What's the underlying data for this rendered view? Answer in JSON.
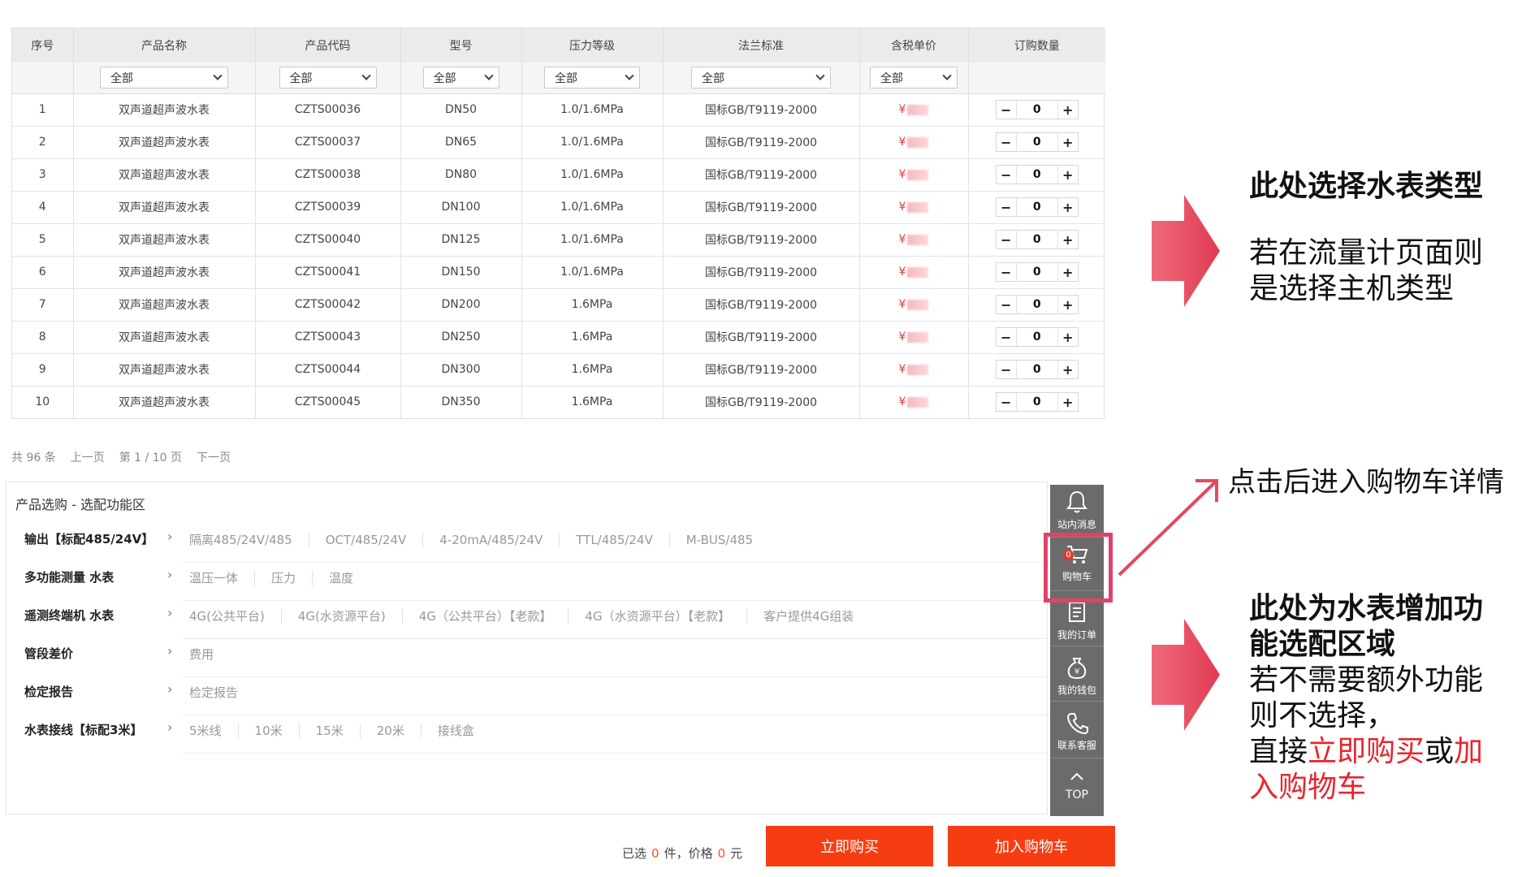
{
  "table": {
    "headers": [
      "序号",
      "产品名称",
      "产品代码",
      "型号",
      "压力等级",
      "法兰标准",
      "含税单价",
      "订购数量"
    ],
    "filter_value": "全部",
    "price_symbol": "¥",
    "rows": [
      {
        "no": "1",
        "name": "双声道超声波水表",
        "code": "CZTS00036",
        "model": "DN50",
        "pressure": "1.0/1.6MPa",
        "standard": "国标GB/T9119-2000",
        "qty": "0"
      },
      {
        "no": "2",
        "name": "双声道超声波水表",
        "code": "CZTS00037",
        "model": "DN65",
        "pressure": "1.0/1.6MPa",
        "standard": "国标GB/T9119-2000",
        "qty": "0"
      },
      {
        "no": "3",
        "name": "双声道超声波水表",
        "code": "CZTS00038",
        "model": "DN80",
        "pressure": "1.0/1.6MPa",
        "standard": "国标GB/T9119-2000",
        "qty": "0"
      },
      {
        "no": "4",
        "name": "双声道超声波水表",
        "code": "CZTS00039",
        "model": "DN100",
        "pressure": "1.0/1.6MPa",
        "standard": "国标GB/T9119-2000",
        "qty": "0"
      },
      {
        "no": "5",
        "name": "双声道超声波水表",
        "code": "CZTS00040",
        "model": "DN125",
        "pressure": "1.0/1.6MPa",
        "standard": "国标GB/T9119-2000",
        "qty": "0"
      },
      {
        "no": "6",
        "name": "双声道超声波水表",
        "code": "CZTS00041",
        "model": "DN150",
        "pressure": "1.0/1.6MPa",
        "standard": "国标GB/T9119-2000",
        "qty": "0"
      },
      {
        "no": "7",
        "name": "双声道超声波水表",
        "code": "CZTS00042",
        "model": "DN200",
        "pressure": "1.6MPa",
        "standard": "国标GB/T9119-2000",
        "qty": "0"
      },
      {
        "no": "8",
        "name": "双声道超声波水表",
        "code": "CZTS00043",
        "model": "DN250",
        "pressure": "1.6MPa",
        "standard": "国标GB/T9119-2000",
        "qty": "0"
      },
      {
        "no": "9",
        "name": "双声道超声波水表",
        "code": "CZTS00044",
        "model": "DN300",
        "pressure": "1.6MPa",
        "standard": "国标GB/T9119-2000",
        "qty": "0"
      },
      {
        "no": "10",
        "name": "双声道超声波水表",
        "code": "CZTS00045",
        "model": "DN350",
        "pressure": "1.6MPa",
        "standard": "国标GB/T9119-2000",
        "qty": "0"
      }
    ]
  },
  "pager": {
    "total": "共 96 条",
    "prev": "上一页",
    "current": "第 1 / 10 页",
    "next": "下一页"
  },
  "options": {
    "title": "产品选购 - 选配功能区",
    "caret": "›",
    "groups": [
      {
        "label": "输出【标配485/24V】",
        "items": [
          "隔离485/24V/485",
          "OCT/485/24V",
          "4-20mA/485/24V",
          "TTL/485/24V",
          "M-BUS/485"
        ]
      },
      {
        "label": "多功能测量 水表",
        "items": [
          "温压一体",
          "压力",
          "温度"
        ]
      },
      {
        "label": "遥测终端机 水表",
        "items": [
          "4G(公共平台)",
          "4G(水资源平台)",
          "4G（公共平台）【老款】",
          "4G（水资源平台）【老款】",
          "客户提供4G组装"
        ]
      },
      {
        "label": "管段差价",
        "items": [
          "费用"
        ]
      },
      {
        "label": "检定报告",
        "items": [
          "检定报告"
        ]
      },
      {
        "label": "水表接线【标配3米】",
        "items": [
          "5米线",
          "10米",
          "15米",
          "20米",
          "接线盒"
        ]
      }
    ]
  },
  "toolbar": {
    "messages": "站内消息",
    "cart": "购物车",
    "cart_count": "0",
    "orders": "我的订单",
    "wallet": "我的钱包",
    "service": "联系客服",
    "top": "TOP"
  },
  "buy_bar": {
    "selected_prefix": "已选",
    "selected_count": "0",
    "selected_unit": "件，价格",
    "price": "0",
    "currency": "元",
    "buy_now": "立即购买",
    "add_to_cart": "加入购物车"
  },
  "annotations": {
    "meter_type_title": "此处选择水表类型",
    "meter_type_body_1": "若在流量计页面则",
    "meter_type_body_2": "是选择主机类型",
    "cart_hint": "点击后进入购物车详情",
    "options_title_1": "此处为水表增加功",
    "options_title_2": "能选配区域",
    "options_body_1": "若不需要额外功能",
    "options_body_2": "则不选择，",
    "options_body_3_prefix": "直接",
    "options_body_3_buy": "立即购买",
    "options_body_3_or": "或",
    "options_body_3_cart_a": "加",
    "options_body_4_cart_b": "入购物车"
  },
  "colors": {
    "accent_red": "#f63d12",
    "annotation_red": "#e8262f",
    "arrow_pink": "#e24a5e",
    "highlight_pink": "#e0426a",
    "toolbar_gray": "#6b6b6b"
  }
}
